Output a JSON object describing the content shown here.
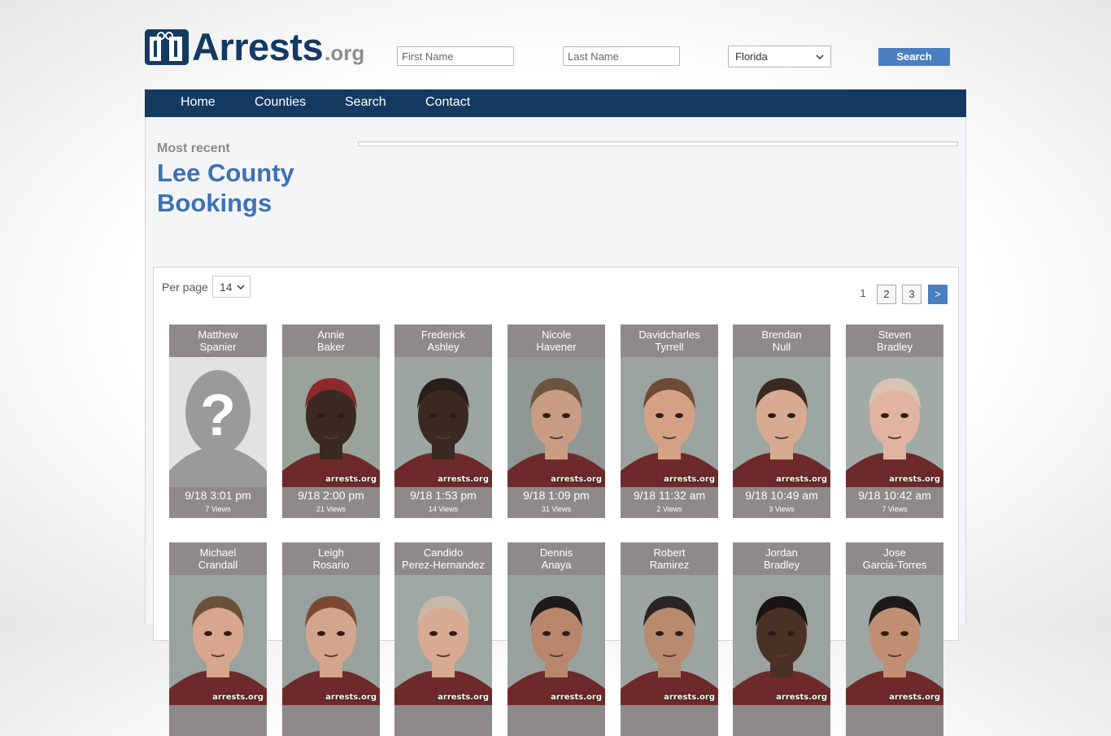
{
  "header": {
    "logo_text": "Arrests",
    "logo_suffix": ".org",
    "first_name_placeholder": "First Name",
    "last_name_placeholder": "Last Name",
    "state_value": "Florida",
    "search_label": "Search"
  },
  "nav": {
    "items": [
      {
        "label": "Home"
      },
      {
        "label": "Counties"
      },
      {
        "label": "Search"
      },
      {
        "label": "Contact"
      }
    ]
  },
  "page": {
    "subtitle": "Most recent",
    "title_line1": "Lee County",
    "title_line2": "Bookings"
  },
  "controls": {
    "per_page_label": "Per page",
    "per_page_value": "14",
    "pages": [
      "1",
      "2",
      "3"
    ],
    "next_label": ">"
  },
  "watermark": "arrests.org",
  "bookings": [
    {
      "first": "Matthew",
      "last": "Spanier",
      "date": "9/18 3:01 pm",
      "views": "7 Views",
      "photo": "placeholder-silhouette",
      "skin": "#cfcfcf",
      "bg": "#e2e2e2"
    },
    {
      "first": "Annie",
      "last": "Baker",
      "date": "9/18 2:00 pm",
      "views": "21 Views",
      "photo": "mugshot",
      "skin": "#3b2a22",
      "bg": "#9aa39a",
      "hair": "#8b2a2a"
    },
    {
      "first": "Frederick",
      "last": "Ashley",
      "date": "9/18 1:53 pm",
      "views": "14 Views",
      "photo": "mugshot",
      "skin": "#3a2a22",
      "bg": "#9ca59f",
      "hair": "#2a1e1a"
    },
    {
      "first": "Nicole",
      "last": "Havener",
      "date": "9/18 1:09 pm",
      "views": "31 Views",
      "photo": "mugshot",
      "skin": "#c99c84",
      "bg": "#8f9894",
      "hair": "#6b5440"
    },
    {
      "first": "Davidcharles",
      "last": "Tyrrell",
      "date": "9/18 11:32 am",
      "views": "2 Views",
      "photo": "mugshot",
      "skin": "#d4a184",
      "bg": "#9aa39f",
      "hair": "#6d4b35"
    },
    {
      "first": "Brendan",
      "last": "Null",
      "date": "9/18 10:49 am",
      "views": "3 Views",
      "photo": "mugshot",
      "skin": "#d9aa92",
      "bg": "#9ca6a2",
      "hair": "#3b2a20"
    },
    {
      "first": "Steven",
      "last": "Bradley",
      "date": "9/18 10:42 am",
      "views": "7 Views",
      "photo": "mugshot",
      "skin": "#e0b4a0",
      "bg": "#a2aaa6",
      "hair": "#d8c4b4"
    },
    {
      "first": "Michael",
      "last": "Crandall",
      "date": "",
      "views": "",
      "photo": "mugshot",
      "skin": "#d8a68c",
      "bg": "#9aa39f",
      "hair": "#6b5139"
    },
    {
      "first": "Leigh",
      "last": "Rosario",
      "date": "",
      "views": "",
      "photo": "mugshot",
      "skin": "#d3a58c",
      "bg": "#98a19d",
      "hair": "#7a4a30"
    },
    {
      "first": "Candido",
      "last": "Perez-Hernandez",
      "date": "",
      "views": "",
      "photo": "mugshot",
      "skin": "#d8aa92",
      "bg": "#a0a8a4",
      "hair": "#c9b8aa"
    },
    {
      "first": "Dennis",
      "last": "Anaya",
      "date": "",
      "views": "",
      "photo": "mugshot",
      "skin": "#b8866a",
      "bg": "#98a19d",
      "hair": "#1e1a18"
    },
    {
      "first": "Robert",
      "last": "Ramirez",
      "date": "",
      "views": "",
      "photo": "mugshot",
      "skin": "#b88b6f",
      "bg": "#9ca5a1",
      "hair": "#2a2522"
    },
    {
      "first": "Jordan",
      "last": "Bradley",
      "date": "",
      "views": "",
      "photo": "mugshot",
      "skin": "#4a3126",
      "bg": "#9aa39f",
      "hair": "#1a1412"
    },
    {
      "first": "Jose",
      "last": "Garcia-Torres",
      "date": "",
      "views": "",
      "photo": "mugshot",
      "skin": "#c08f72",
      "bg": "#9da6a2",
      "hair": "#1e1a18"
    }
  ]
}
